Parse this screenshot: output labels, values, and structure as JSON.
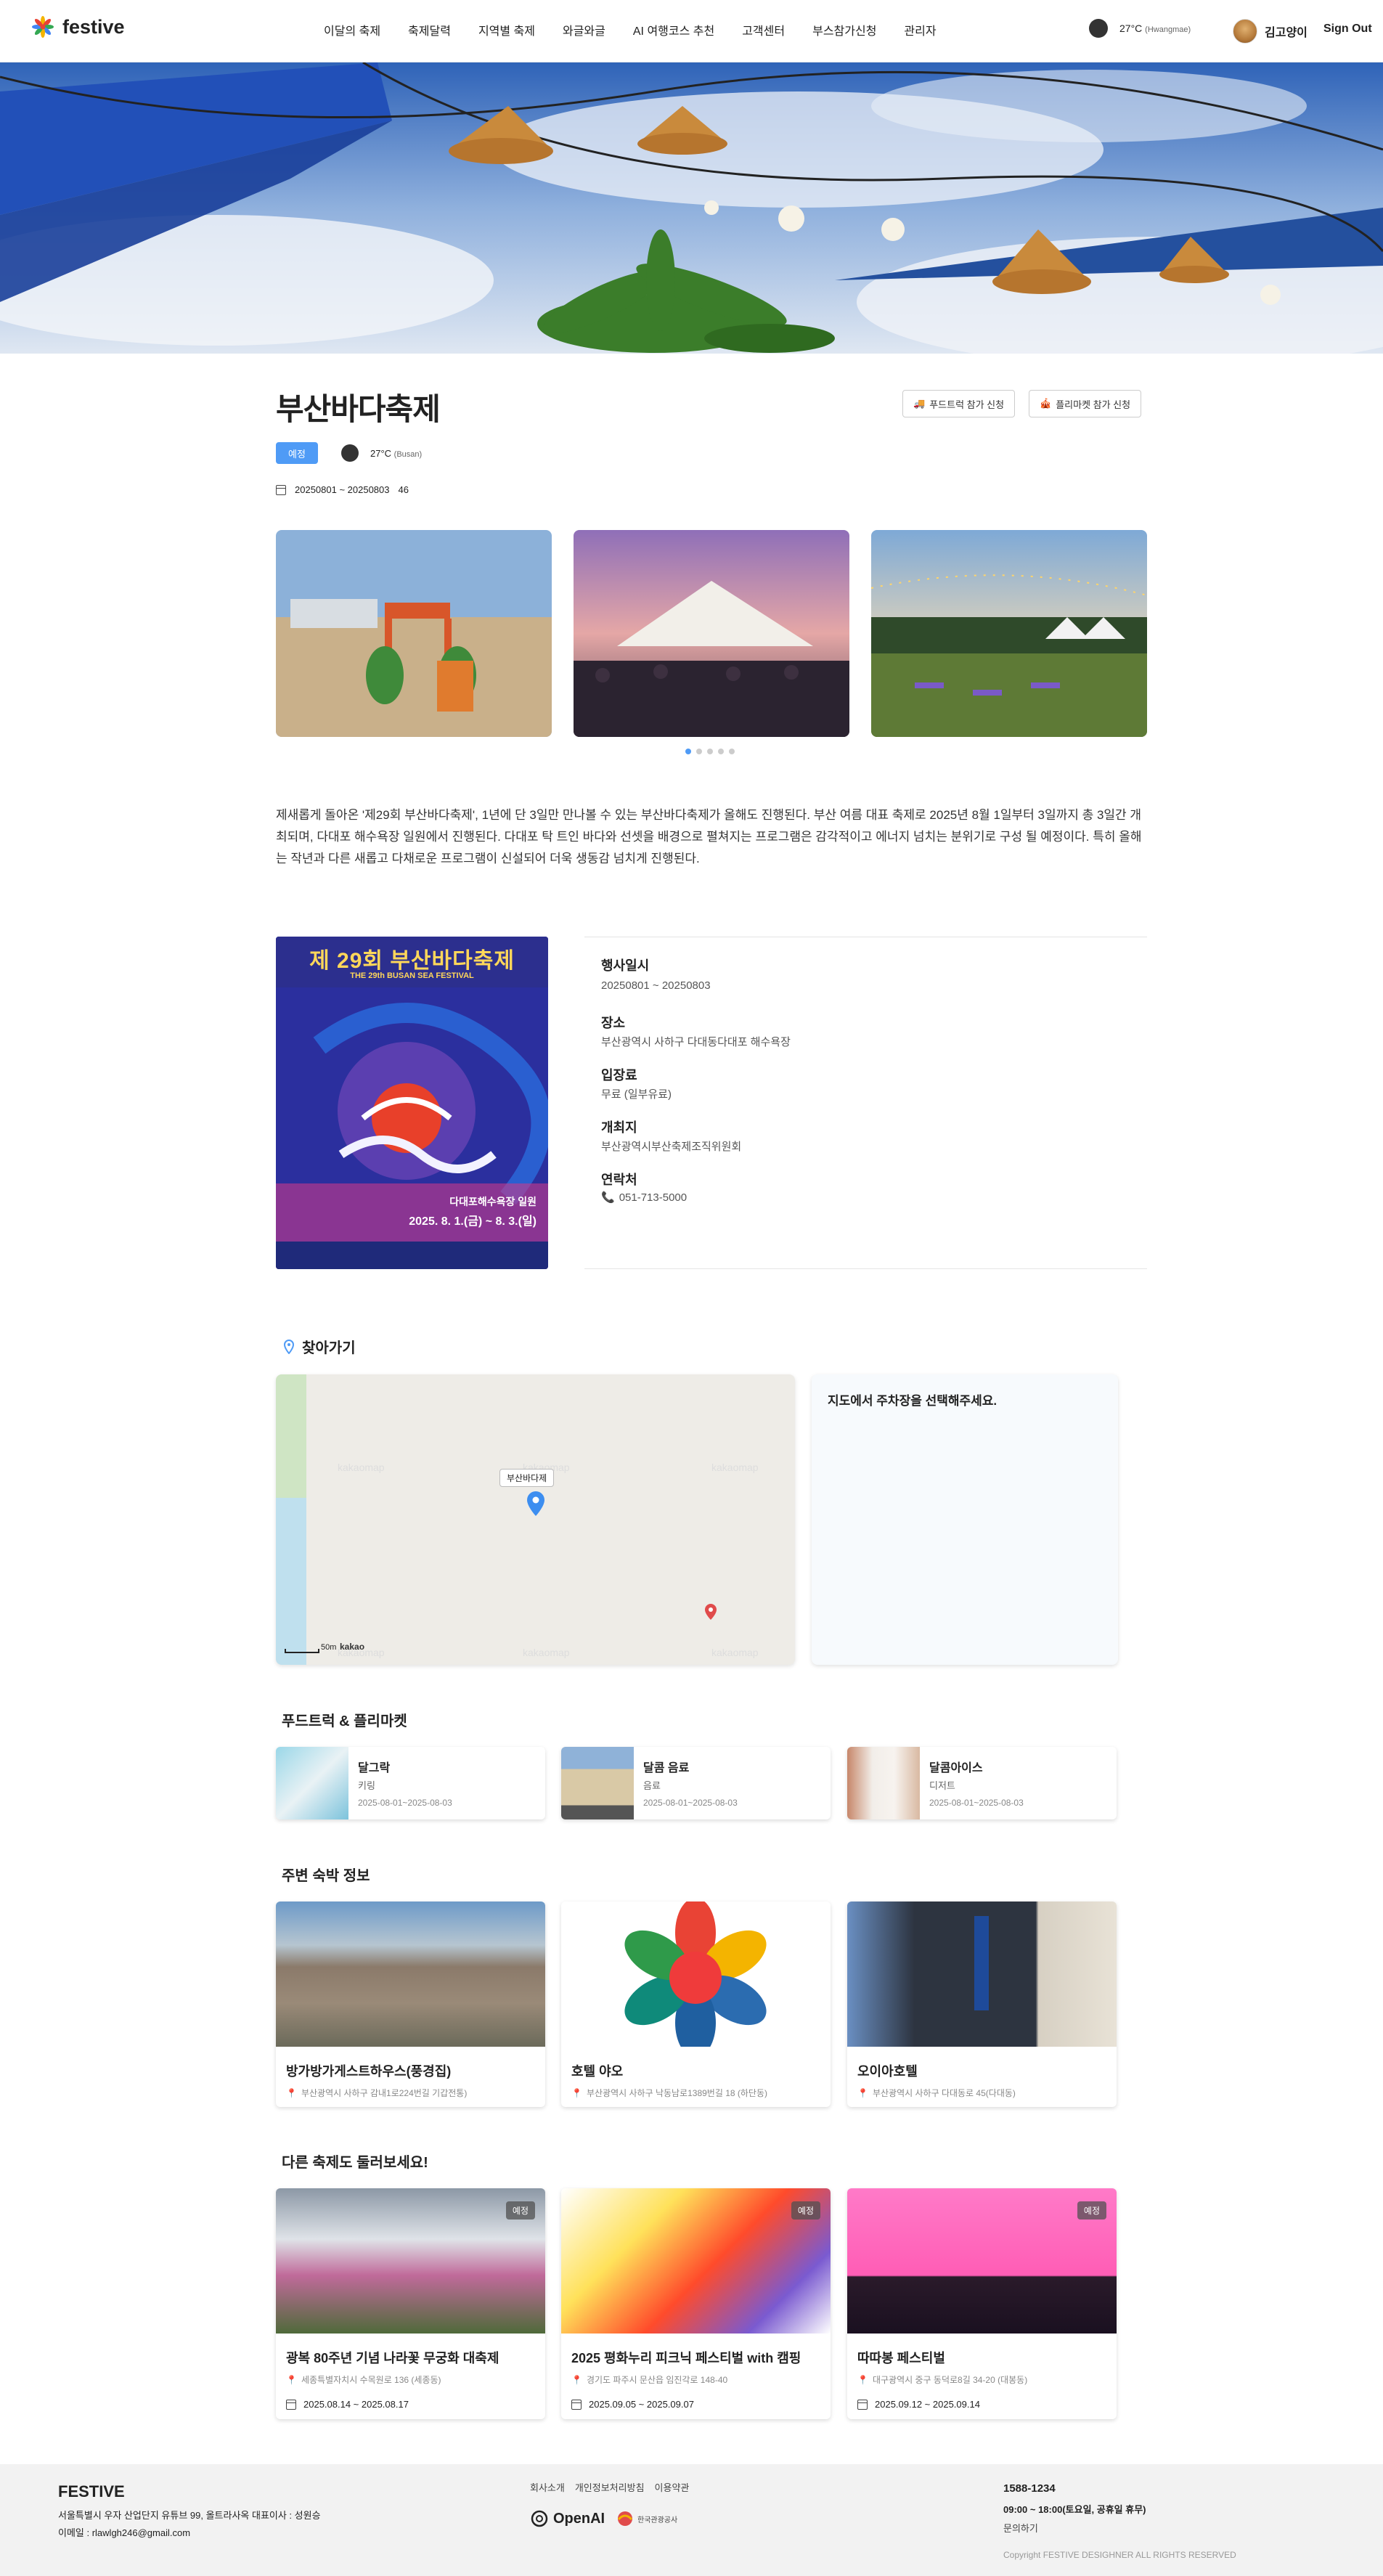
{
  "header": {
    "brand": "festive",
    "nav": [
      "이달의 축제",
      "축제달력",
      "지역별 축제",
      "와글와글",
      "AI 여행코스 추천",
      "고객센터",
      "부스참가신청",
      "관리자"
    ],
    "weather": {
      "temp": "27°C",
      "location": "(Hwangmae)"
    },
    "user": "김고양이",
    "signout": "Sign Out"
  },
  "festival": {
    "title": "부산바다축제",
    "apply_foodtruck": "푸드트럭 참가 신청",
    "apply_fleamarket": "플리마켓 참가 신청",
    "status": "예정",
    "weather_temp": "27°C",
    "weather_loc": "(Busan)",
    "dates": "20250801 ~ 20250803",
    "views": "46",
    "description": "제새롭게 돌아온 '제29회 부산바다축제', 1년에 단 3일만 만나볼 수 있는 부산바다축제가 올해도 진행된다. 부산 여름 대표 축제로 2025년 8월 1일부터 3일까지 총 3일간 개최되며, 다대포 해수욕장 일원에서 진행된다. 다대포 탁 트인 바다와 선셋을 배경으로 펼쳐지는 프로그램은 감각적이고 에너지 넘치는 분위기로 구성 될 예정이다. 특히 올해는 작년과 다른 새롭고 다채로운 프로그램이 신설되어 더욱 생동감 넘치게 진행된다.",
    "poster_title": "제 29회 부산바다축제",
    "poster_sub": "THE 29th BUSAN SEA FESTIVAL",
    "poster_venue": "다대포해수욕장 일원",
    "poster_dates": "2025. 8. 1.(금) ~ 8. 3.(일)"
  },
  "info": {
    "date_label": "행사일시",
    "date_value": "20250801 ~ 20250803",
    "place_label": "장소",
    "place_value": "부산광역시 사하구 다대동다대포 해수욕장",
    "fee_label": "입장료",
    "fee_value": "무료 (일부유료)",
    "host_label": "개최지",
    "host_value": "부산광역시부산축제조직위원회",
    "contact_label": "연락처",
    "contact_value": "051-713-5000"
  },
  "map": {
    "section_title": "찾아가기",
    "marker_label": "부산바다제",
    "scale": "50m",
    "provider": "kakao",
    "watermark": "kakaomap",
    "parking_prompt": "지도에서 주차장을 선택해주세요."
  },
  "food": {
    "section_title": "푸드트럭 & 플리마켓",
    "items": [
      {
        "name": "달그락",
        "category": "키링",
        "dates": "2025-08-01~2025-08-03"
      },
      {
        "name": "달콤 음료",
        "category": "음료",
        "dates": "2025-08-01~2025-08-03"
      },
      {
        "name": "달콤아이스",
        "category": "디저트",
        "dates": "2025-08-01~2025-08-03"
      }
    ]
  },
  "lodging": {
    "section_title": "주변 숙박 정보",
    "items": [
      {
        "name": "방가방가게스트하우스(풍경집)",
        "address": "부산광역시 사하구 감내1로224번길 기갑전통)"
      },
      {
        "name": "호텔 야오",
        "address": "부산광역시 사하구 낙동남로1389번길 18 (하단동)"
      },
      {
        "name": "오이아호텔",
        "address": "부산광역시 사하구 다대동로 45(다대동)"
      }
    ]
  },
  "others": {
    "section_title": "다른 축제도 둘러보세요!",
    "items": [
      {
        "name": "광복 80주년 기념 나라꽃 무궁화 대축제",
        "address": "세종특별자치시 수목원로 136 (세종동)",
        "dates": "2025.08.14 ~ 2025.08.17",
        "tag": "예정"
      },
      {
        "name": "2025 평화누리 피크닉 페스티벌 with 캠핑",
        "address": "경기도 파주시 문산읍 임진각로 148-40",
        "dates": "2025.09.05 ~ 2025.09.07",
        "tag": "예정"
      },
      {
        "name": "따따봉 페스티벌",
        "address": "대구광역시 중구 동덕로8길 34-20 (대봉동)",
        "dates": "2025.09.12 ~ 2025.09.14",
        "tag": "예정"
      }
    ]
  },
  "footer": {
    "brand": "FESTIVE",
    "address": "서울특별시 우자 산업단지 유튜브 99, 올트라사옥 대표이사 : 성원승",
    "email": "이메일 : rlawlgh246@gmail.com",
    "links": [
      "회사소개",
      "개인정보처리방침",
      "이용약관"
    ],
    "openai": "OpenAI",
    "kto": "한국관광공사",
    "phone": "1588-1234",
    "hours": "09:00 ~ 18:00(토요일, 공휴일 휴무)",
    "inquiry": "문의하기",
    "copyright": "Copyright FESTIVE DESIGHNER ALL RIGHTS RESERVED"
  },
  "colors": {
    "accent": "#4f9bf6",
    "footer_bg": "#f2f2f2",
    "marker": "#3d8ef0"
  }
}
